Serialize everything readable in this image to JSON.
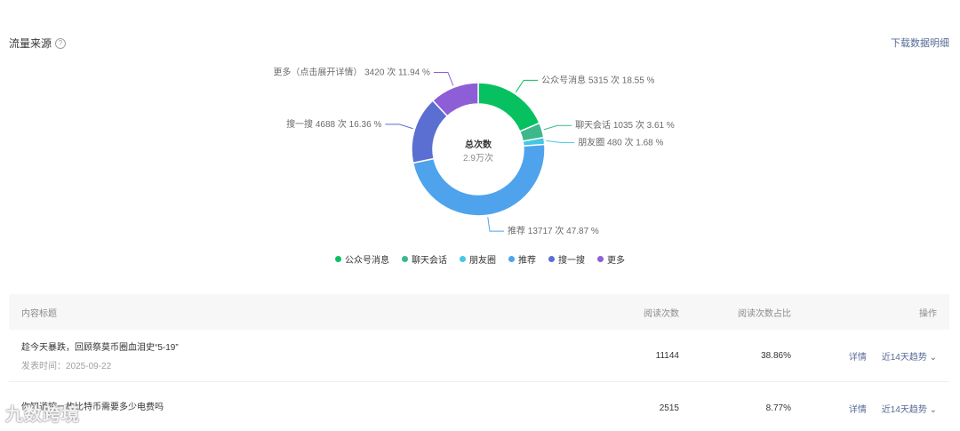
{
  "section": {
    "title": "流量来源",
    "help_icon": "?",
    "download_label": "下载数据明细"
  },
  "chart_data": {
    "type": "pie",
    "center": {
      "title": "总次数",
      "value": "2.9万次"
    },
    "slices": [
      {
        "name": "公众号消息",
        "value": 5315,
        "percent": 18.55,
        "label": "公众号消息 5315 次 18.55 %",
        "color": "#07c160"
      },
      {
        "name": "聊天会话",
        "value": 1035,
        "percent": 3.61,
        "label": "聊天会话 1035 次 3.61 %",
        "color": "#3cb88a"
      },
      {
        "name": "朋友圈",
        "value": 480,
        "percent": 1.68,
        "label": "朋友圈 480 次 1.68 %",
        "color": "#45c7e3"
      },
      {
        "name": "推荐",
        "value": 13717,
        "percent": 47.87,
        "label": "推荐 13717 次 47.87 %",
        "color": "#4fa3ec"
      },
      {
        "name": "搜一搜",
        "value": 4688,
        "percent": 16.36,
        "label": "搜一搜 4688 次 16.36 %",
        "color": "#5b6ed1"
      },
      {
        "name": "更多",
        "value": 3420,
        "percent": 11.94,
        "label": "更多（点击展开详情） 3420 次 11.94 %",
        "color": "#8e5ed6"
      }
    ],
    "legend": [
      "公众号消息",
      "聊天会话",
      "朋友圈",
      "推荐",
      "搜一搜",
      "更多"
    ]
  },
  "table": {
    "headers": {
      "title": "内容标题",
      "reads": "阅读次数",
      "ratio": "阅读次数占比",
      "ops": "操作"
    },
    "rows": [
      {
        "title": "趁今天暴跌，回顾祭莫币圈血泪史“5-19”",
        "date": "发表时间：2025-09-22",
        "reads": "11144",
        "ratio": "38.86%",
        "detail": "详情",
        "trend": "近14天趋势"
      },
      {
        "title": "你知道挖一枚比特币需要多少电费吗",
        "date": "",
        "reads": "2515",
        "ratio": "8.77%",
        "detail": "详情",
        "trend": "近14天趋势"
      }
    ]
  },
  "watermark": "九数跨境"
}
